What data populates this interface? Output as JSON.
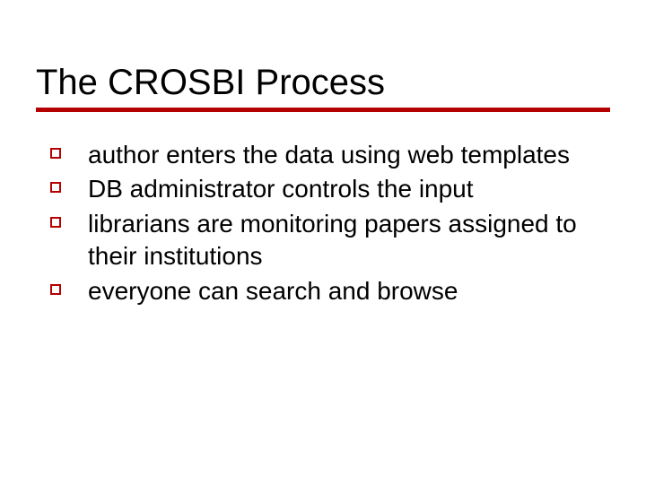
{
  "title": "The CROSBI Process",
  "accent_color": "#b40000",
  "bullets": [
    "author enters the data using web templates",
    "DB administrator controls the input",
    "librarians are monitoring papers assigned to their institutions",
    "everyone can search and browse"
  ]
}
